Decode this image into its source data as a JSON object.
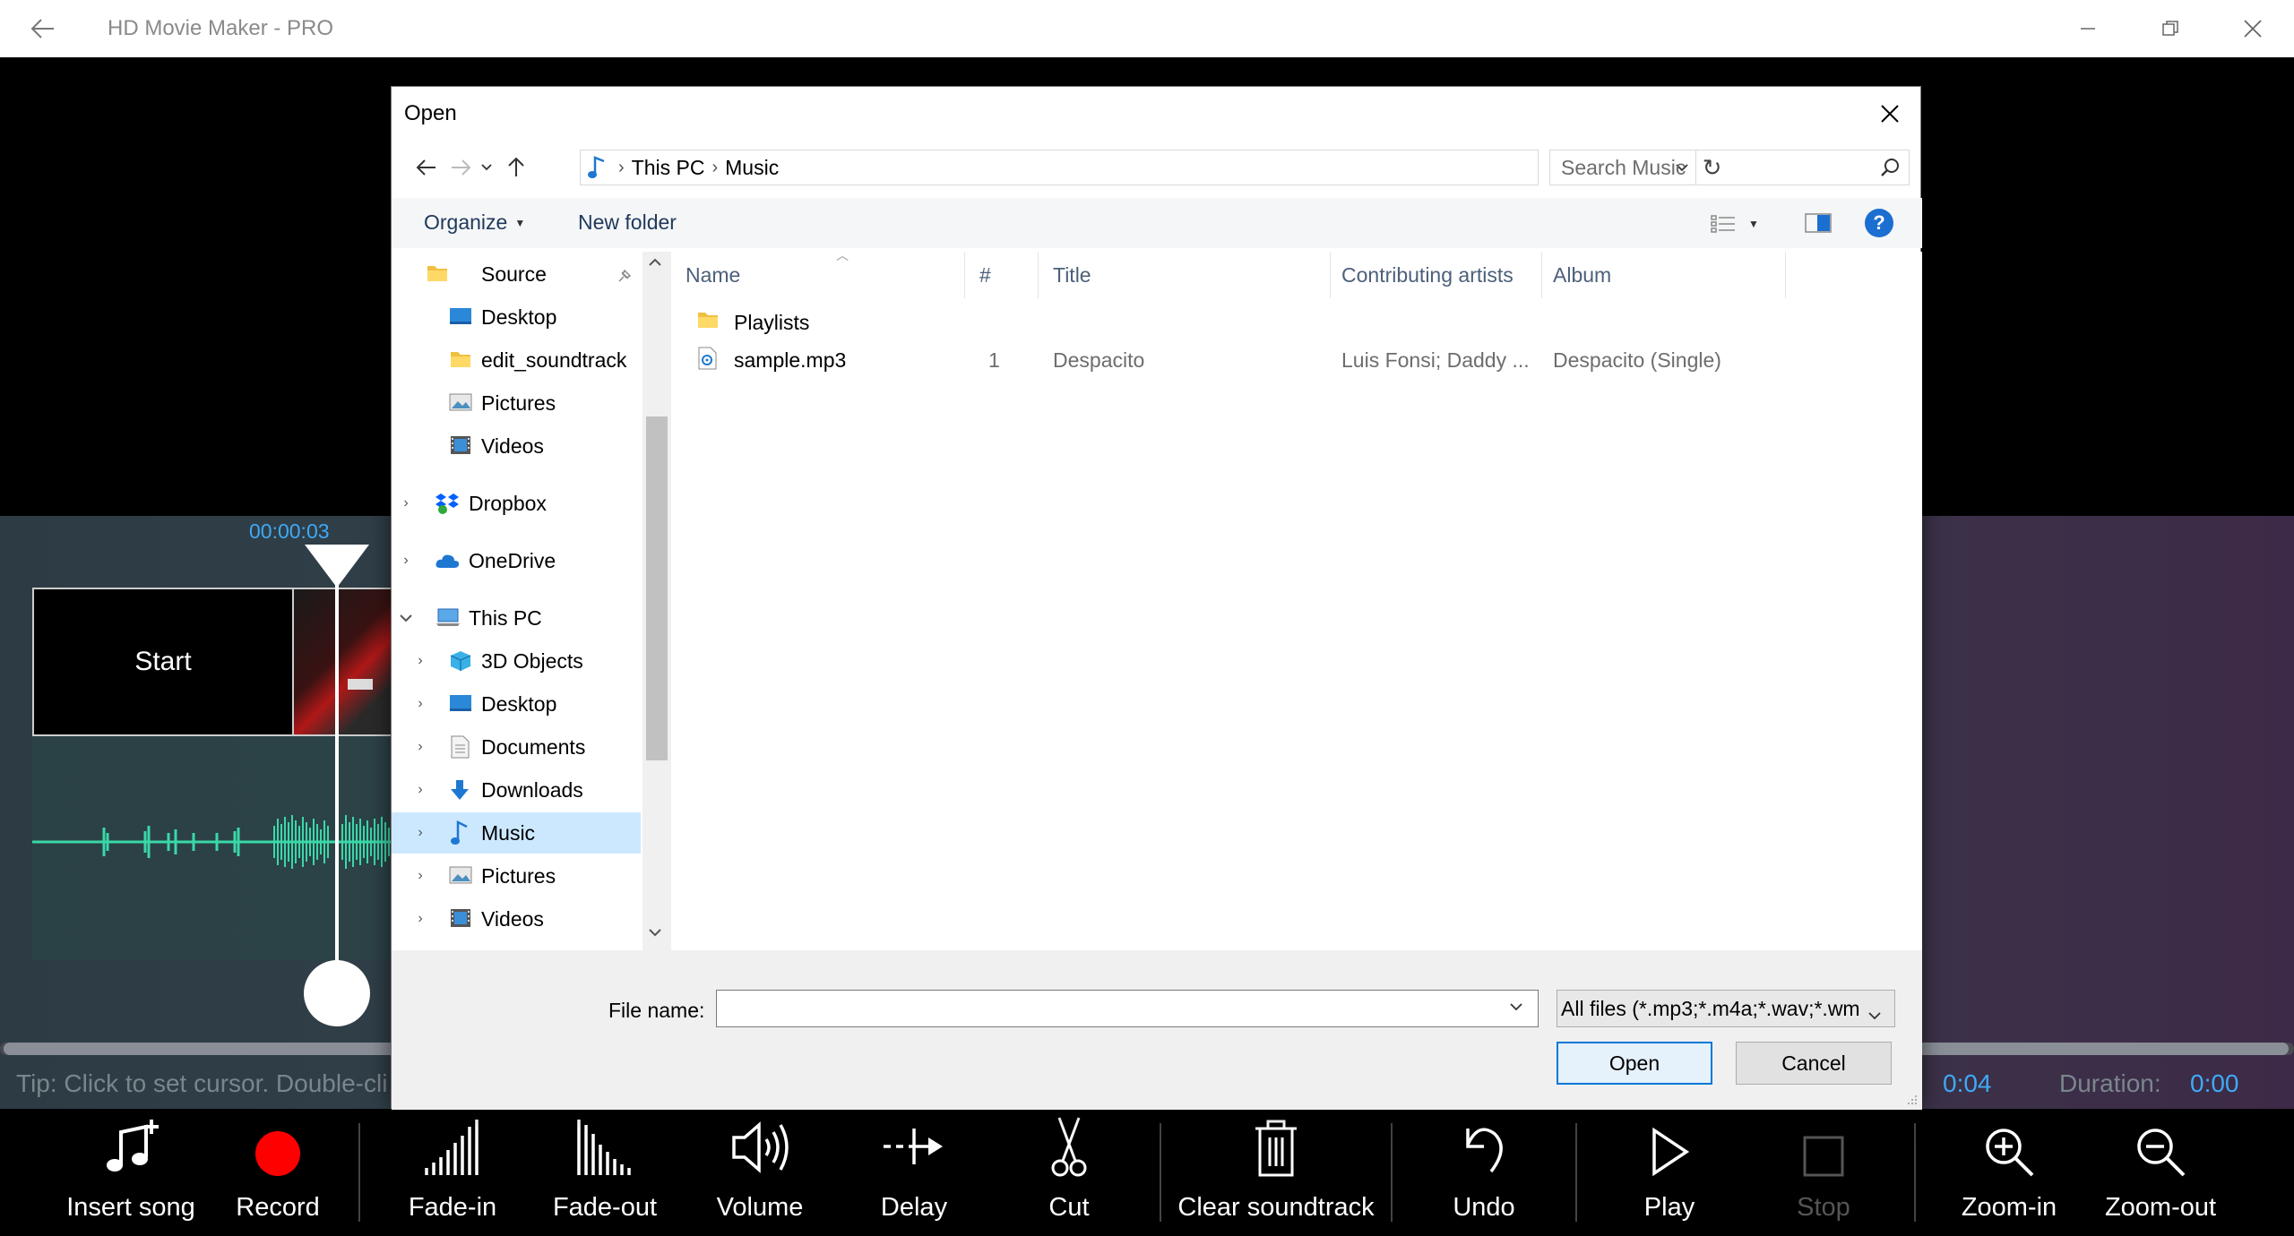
{
  "app": {
    "title": "HD Movie Maker - PRO"
  },
  "timeline": {
    "cursor_time": "00:00:03",
    "clip_label": "Start",
    "tip": "Tip: Click to set cursor. Double-cli",
    "position_value": "0:04",
    "duration_label": "Duration:",
    "duration_value": "0:00"
  },
  "toolbar": {
    "insert_song": "Insert song",
    "record": "Record",
    "fade_in": "Fade-in",
    "fade_out": "Fade-out",
    "volume": "Volume",
    "delay": "Delay",
    "cut": "Cut",
    "clear_soundtrack": "Clear soundtrack",
    "undo": "Undo",
    "play": "Play",
    "stop": "Stop",
    "zoom_in": "Zoom-in",
    "zoom_out": "Zoom-out"
  },
  "dialog": {
    "title": "Open",
    "breadcrumb": [
      "This PC",
      "Music"
    ],
    "search_placeholder": "Search Music",
    "organize": "Organize",
    "new_folder": "New folder",
    "help": "?",
    "tree": [
      {
        "label": "Source"
      },
      {
        "label": "Desktop"
      },
      {
        "label": "edit_soundtrack"
      },
      {
        "label": "Pictures"
      },
      {
        "label": "Videos"
      },
      {
        "label": "Dropbox"
      },
      {
        "label": "OneDrive"
      },
      {
        "label": "This PC"
      },
      {
        "label": "3D Objects"
      },
      {
        "label": "Desktop"
      },
      {
        "label": "Documents"
      },
      {
        "label": "Downloads"
      },
      {
        "label": "Music"
      },
      {
        "label": "Pictures"
      },
      {
        "label": "Videos"
      }
    ],
    "columns": [
      "Name",
      "#",
      "Title",
      "Contributing artists",
      "Album"
    ],
    "files": [
      {
        "name": "Playlists",
        "number": "",
        "title": "",
        "artists": "",
        "album": ""
      },
      {
        "name": "sample.mp3",
        "number": "1",
        "title": "Despacito",
        "artists": "Luis Fonsi; Daddy ...",
        "album": "Despacito (Single)"
      }
    ],
    "file_name_label": "File name:",
    "file_name_value": "",
    "filter": "All files (*.mp3;*.m4a;*.wav;*.wm",
    "open_button": "Open",
    "cancel_button": "Cancel"
  }
}
